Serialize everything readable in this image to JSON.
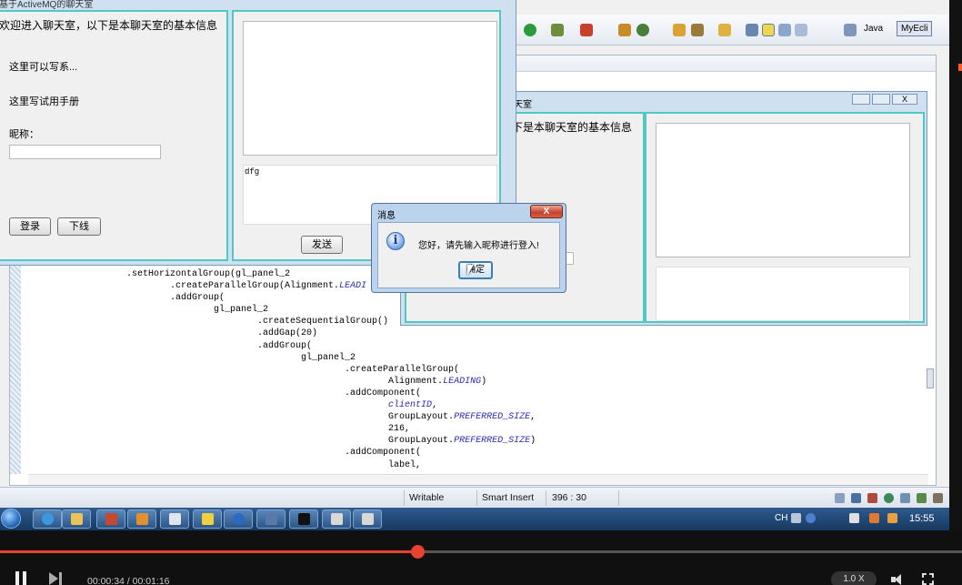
{
  "ide": {
    "perspectives": {
      "java": "Java",
      "myeclipse": "MyEcli"
    },
    "code_lines": [
      [
        ".setHorizontalGroup(gl_panel_2",
        ""
      ],
      [
        "        .createParallelGroup(Alignment.",
        "LEADI"
      ],
      [
        "        .addGroup(",
        ""
      ],
      [
        "                gl_panel_2",
        ""
      ],
      [
        "                        .createSequentialGroup()",
        ""
      ],
      [
        "                        .addGap(20)",
        ""
      ],
      [
        "                        .addGroup(",
        ""
      ],
      [
        "                                gl_panel_2",
        ""
      ],
      [
        "                                        .createParallelGroup(",
        ""
      ],
      [
        "                                                Alignment.",
        "LEADING",
        ")"
      ],
      [
        "                                        .addComponent(",
        ""
      ],
      [
        "                                                ",
        "clientID",
        ","
      ],
      [
        "                                                GroupLayout.",
        "PREFERRED_SIZE",
        ","
      ],
      [
        "                                                216,",
        ""
      ],
      [
        "                                                GroupLayout.",
        "PREFERRED_SIZE",
        ")"
      ],
      [
        "                                        .addComponent(",
        ""
      ],
      [
        "                                                label,",
        ""
      ]
    ],
    "status": {
      "writable": "Writable",
      "insert_mode": "Smart Insert",
      "position": "396 : 30"
    }
  },
  "chat_front": {
    "title": "基于ActiveMQ的聊天室",
    "welcome": "欢迎进入聊天室，以下是本聊天室的基本信息",
    "info1": "这里可以写系...",
    "info2": "这里写试用手册",
    "nickname_label": "昵称：",
    "nickname_value": "",
    "login_label": "登录",
    "logout_label": "下线",
    "message_value": "dfg",
    "send_label": "发送"
  },
  "chat_back": {
    "title": "天室",
    "welcome": "下是本聊天室的基本信息"
  },
  "dialog": {
    "title": "消息",
    "close": "X",
    "message": "您好，请先输入昵称进行登入!",
    "ok_label": "确定"
  },
  "taskbar": {
    "lang": "CH",
    "clock": "15:55"
  },
  "player": {
    "time": "00:00:34 / 00:01:16",
    "speed": "1.0 X",
    "progress": 0.434
  },
  "colors": {
    "accent": "#4ec9c4",
    "progress": "#e8432e"
  }
}
